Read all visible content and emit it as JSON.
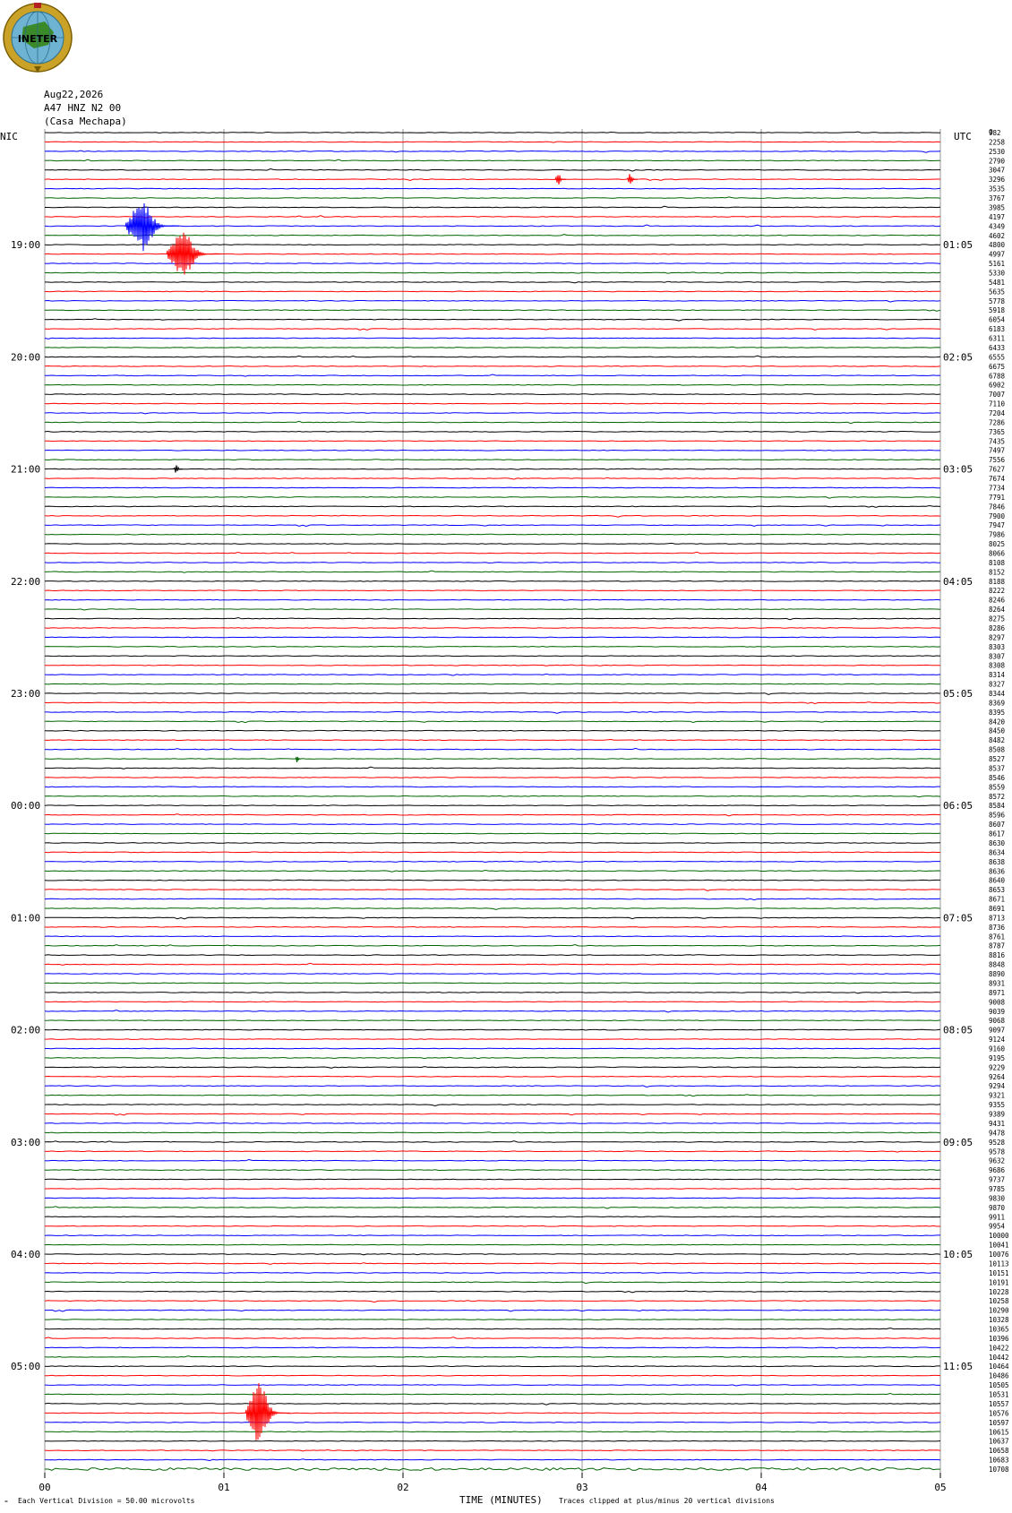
{
  "logo": {
    "text": "INETER",
    "colors": {
      "ring": "#c9a227",
      "globe": "#6fb3d2",
      "land": "#3a8a2a"
    }
  },
  "header": {
    "date": "Aug22,2026",
    "station": "A47 HNZ N2 00",
    "site": "(Casa Mechapa)",
    "left_tz": "NIC",
    "right_tz": "UTC",
    "right_col_header": "0"
  },
  "footer": {
    "scale_note": "Each Vertical Division =    50.00 microvolts",
    "xlabel": "TIME (MINUTES)",
    "clip_note": "Traces clipped at plus/minus 20 vertical divisions"
  },
  "chart_data": {
    "type": "line",
    "subtype": "helicorder",
    "title": "",
    "xlabel": "TIME (MINUTES)",
    "xlim": [
      0,
      5
    ],
    "x_ticks": [
      "00",
      "01",
      "02",
      "03",
      "04",
      "05"
    ],
    "trace_minutes": 5,
    "trace_count": 144,
    "trace_colors": [
      "#000000",
      "#ff0000",
      "#0000ff",
      "#006400"
    ],
    "grid_color": "#808080",
    "left_time_labels": [
      {
        "trace": 12,
        "label": "19:00"
      },
      {
        "trace": 24,
        "label": "20:00"
      },
      {
        "trace": 36,
        "label": "21:00"
      },
      {
        "trace": 48,
        "label": "22:00"
      },
      {
        "trace": 60,
        "label": "23:00"
      },
      {
        "trace": 72,
        "label": "00:00"
      },
      {
        "trace": 84,
        "label": "01:00"
      },
      {
        "trace": 96,
        "label": "02:00"
      },
      {
        "trace": 108,
        "label": "03:00"
      },
      {
        "trace": 120,
        "label": "04:00"
      },
      {
        "trace": 132,
        "label": "05:00"
      }
    ],
    "right_time_labels": [
      {
        "trace": 12,
        "label": "01:05"
      },
      {
        "trace": 24,
        "label": "02:05"
      },
      {
        "trace": 36,
        "label": "03:05"
      },
      {
        "trace": 48,
        "label": "04:05"
      },
      {
        "trace": 60,
        "label": "05:05"
      },
      {
        "trace": 72,
        "label": "06:05"
      },
      {
        "trace": 84,
        "label": "07:05"
      },
      {
        "trace": 96,
        "label": "08:05"
      },
      {
        "trace": 108,
        "label": "09:05"
      },
      {
        "trace": 120,
        "label": "10:05"
      },
      {
        "trace": 132,
        "label": "11:05"
      }
    ],
    "right_values": [
      "982",
      "2258",
      "2530",
      "2790",
      "3047",
      "3296",
      "3535",
      "3767",
      "3985",
      "4197",
      "4349",
      "4602",
      "4800",
      "4997",
      "5161",
      "5330",
      "5481",
      "5635",
      "5778",
      "5918",
      "6054",
      "6183",
      "6311",
      "6433",
      "6555",
      "6675",
      "6788",
      "6902",
      "7007",
      "7110",
      "7204",
      "7286",
      "7365",
      "7435",
      "7497",
      "7556",
      "7627",
      "7674",
      "7734",
      "7791",
      "7846",
      "7900",
      "7947",
      "7986",
      "8025",
      "8066",
      "8108",
      "8152",
      "8188",
      "8222",
      "8246",
      "8264",
      "8275",
      "8286",
      "8297",
      "8303",
      "8307",
      "8308",
      "8314",
      "8327",
      "8344",
      "8369",
      "8395",
      "8420",
      "8450",
      "8482",
      "8508",
      "8527",
      "8537",
      "8546",
      "8559",
      "8572",
      "8584",
      "8596",
      "8607",
      "8617",
      "8630",
      "8634",
      "8638",
      "8636",
      "8640",
      "8653",
      "8671",
      "8691",
      "8713",
      "8736",
      "8761",
      "8787",
      "8816",
      "8848",
      "8890",
      "8931",
      "8971",
      "9008",
      "9039",
      "9068",
      "9097",
      "9124",
      "9160",
      "9195",
      "9229",
      "9264",
      "9294",
      "9321",
      "9355",
      "9389",
      "9431",
      "9478",
      "9528",
      "9578",
      "9632",
      "9686",
      "9737",
      "9785",
      "9830",
      "9870",
      "9911",
      "9954",
      "10000",
      "10041",
      "10076",
      "10113",
      "10151",
      "10191",
      "10228",
      "10258",
      "10290",
      "10328",
      "10365",
      "10396",
      "10422",
      "10442",
      "10464",
      "10486",
      "10505",
      "10531",
      "10557",
      "10576",
      "10597",
      "10615",
      "10637",
      "10658",
      "10683",
      "10708"
    ],
    "events": [
      {
        "trace": 10,
        "minute": 0.45,
        "amp_divisions": 5.5,
        "duration_min": 0.3
      },
      {
        "trace": 13,
        "minute": 0.68,
        "amp_divisions": 5.0,
        "duration_min": 0.3
      },
      {
        "trace": 36,
        "minute": 0.72,
        "amp_divisions": 1.0,
        "duration_min": 0.05
      },
      {
        "trace": 137,
        "minute": 1.12,
        "amp_divisions": 6.5,
        "duration_min": 0.25
      },
      {
        "trace": 5,
        "minute": 2.85,
        "amp_divisions": 1.2,
        "duration_min": 0.06
      },
      {
        "trace": 5,
        "minute": 3.25,
        "amp_divisions": 1.2,
        "duration_min": 0.06
      },
      {
        "trace": 67,
        "minute": 1.4,
        "amp_divisions": 0.8,
        "duration_min": 0.03
      }
    ]
  }
}
